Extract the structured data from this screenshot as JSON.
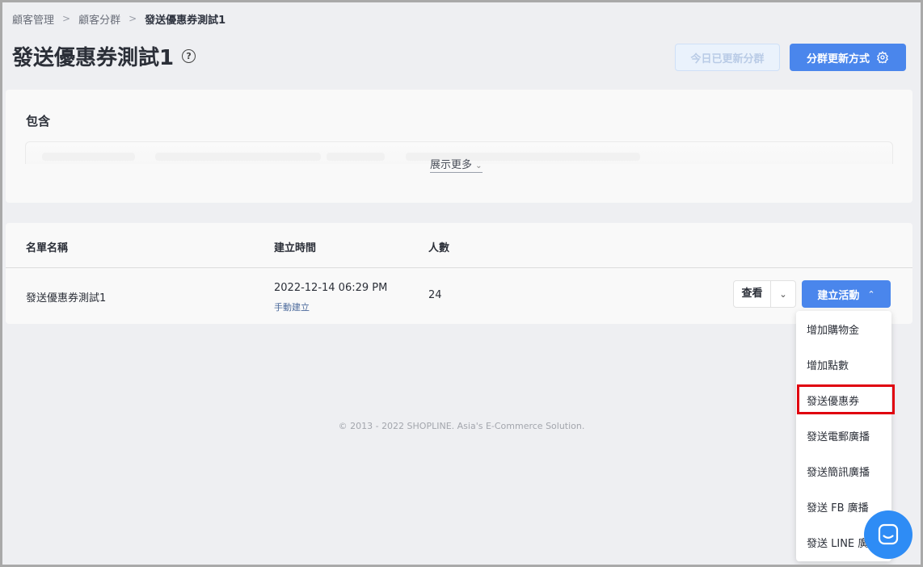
{
  "breadcrumb": {
    "items": [
      "顧客管理",
      "顧客分群",
      "發送優惠券測試1"
    ],
    "separator": ">"
  },
  "header": {
    "title": "發送優惠券測試1",
    "help_glyph": "?",
    "updated_today_label": "今日已更新分群",
    "update_method_label": "分群更新方式"
  },
  "include_section": {
    "title": "包含",
    "show_more_label": "展示更多"
  },
  "table": {
    "columns": [
      "名單名稱",
      "建立時間",
      "人數"
    ],
    "rows": [
      {
        "name": "發送優惠券測試1",
        "created_at": "2022-12-14 06:29 PM",
        "created_by": "手動建立",
        "count": "24"
      }
    ],
    "view_label": "查看",
    "create_campaign_label": "建立活動"
  },
  "dropdown": {
    "items": [
      "增加購物金",
      "增加點數",
      "發送優惠券",
      "發送電郵廣播",
      "發送簡訊廣播",
      "發送 FB 廣播",
      "發送 LINE 廣播"
    ],
    "highlighted_item": "發送優惠券"
  },
  "footer": {
    "text": "© 2013 - 2022 SHOPLINE. Asia's E-Commerce Solution."
  },
  "colors": {
    "primary": "#4a86ec",
    "highlight": "#e0000f",
    "chat": "#2e8cf5"
  }
}
